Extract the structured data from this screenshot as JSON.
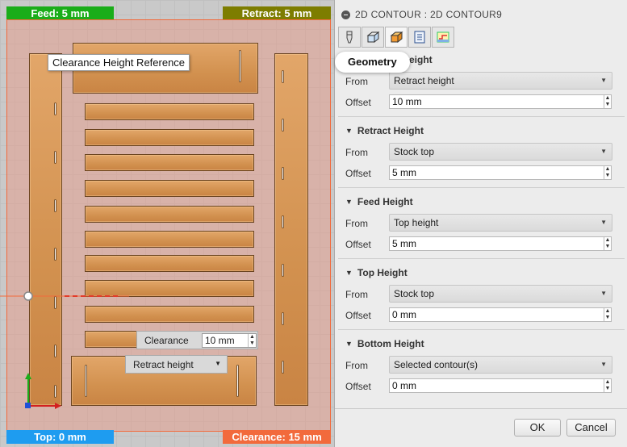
{
  "viewport": {
    "flags": {
      "feed": "Feed: 5 mm",
      "retract": "Retract: 5 mm",
      "top": "Top: 0 mm",
      "clearance": "Clearance: 15 mm"
    },
    "tooltip": "Clearance Height Reference",
    "hud": {
      "clearance_label": "Clearance",
      "clearance_value": "10 mm",
      "reference_select": "Retract height"
    },
    "colors": {
      "feed_flag": "#1aad19",
      "retract_flag": "#7d7d00",
      "top_flag": "#1e9cf0",
      "clearance_flag": "#f26a3c"
    }
  },
  "panel": {
    "title": "2D CONTOUR : 2D CONTOUR9",
    "tabs": [
      {
        "name": "tool-icon"
      },
      {
        "name": "geometry-icon"
      },
      {
        "name": "heights-icon"
      },
      {
        "name": "passes-icon"
      },
      {
        "name": "linking-icon"
      }
    ],
    "active_tab_tooltip": "Geometry",
    "sections": [
      {
        "title": "Clearance Height",
        "title_visible": "eight",
        "from_label": "From",
        "from": "Retract height",
        "offset_label": "Offset",
        "offset": "10 mm"
      },
      {
        "title": "Retract Height",
        "from_label": "From",
        "from": "Stock top",
        "offset_label": "Offset",
        "offset": "5 mm"
      },
      {
        "title": "Feed Height",
        "from_label": "From",
        "from": "Top height",
        "offset_label": "Offset",
        "offset": "5 mm"
      },
      {
        "title": "Top Height",
        "from_label": "From",
        "from": "Stock top",
        "offset_label": "Offset",
        "offset": "0 mm"
      },
      {
        "title": "Bottom Height",
        "from_label": "From",
        "from": "Selected contour(s)",
        "offset_label": "Offset",
        "offset": "0 mm"
      }
    ],
    "ok_label": "OK",
    "cancel_label": "Cancel"
  }
}
